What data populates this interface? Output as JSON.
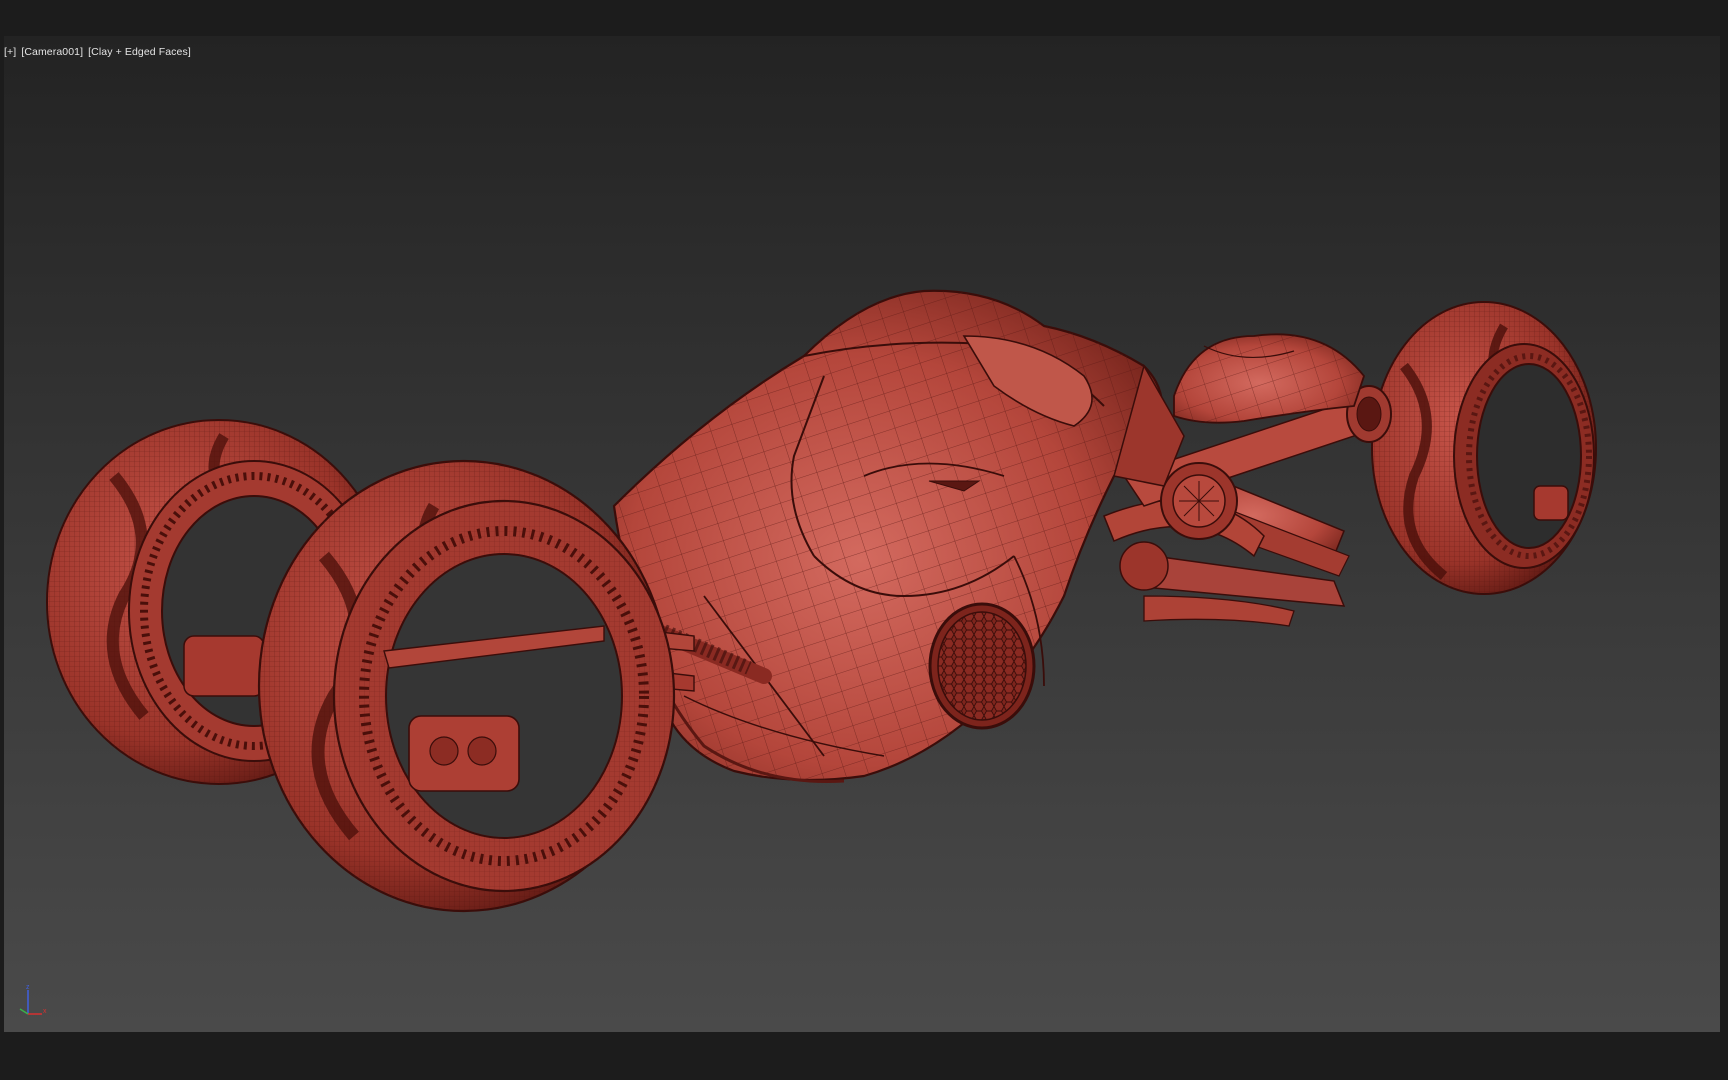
{
  "viewport": {
    "label_plus": "[+]",
    "label_camera": "[Camera001]",
    "label_shading": "[Clay + Edged Faces]"
  },
  "axis_gizmo": {
    "z": "z",
    "x": "x"
  },
  "colors": {
    "clay": "#b8463c",
    "clay_dark": "#5a1712",
    "clay_light": "#d8695d",
    "wire": "#3a0d0a",
    "background_top": "#232323",
    "background_bottom": "#4a4a4a",
    "chrome": "#1c1c1c",
    "axis_x": "#d83030",
    "axis_y": "#3bb04a",
    "axis_z": "#4060e0"
  },
  "objects": [
    "vehicle-body",
    "front-left-wheel",
    "front-right-wheel",
    "rear-wheel",
    "headlight",
    "exhaust-pipes",
    "seat"
  ]
}
